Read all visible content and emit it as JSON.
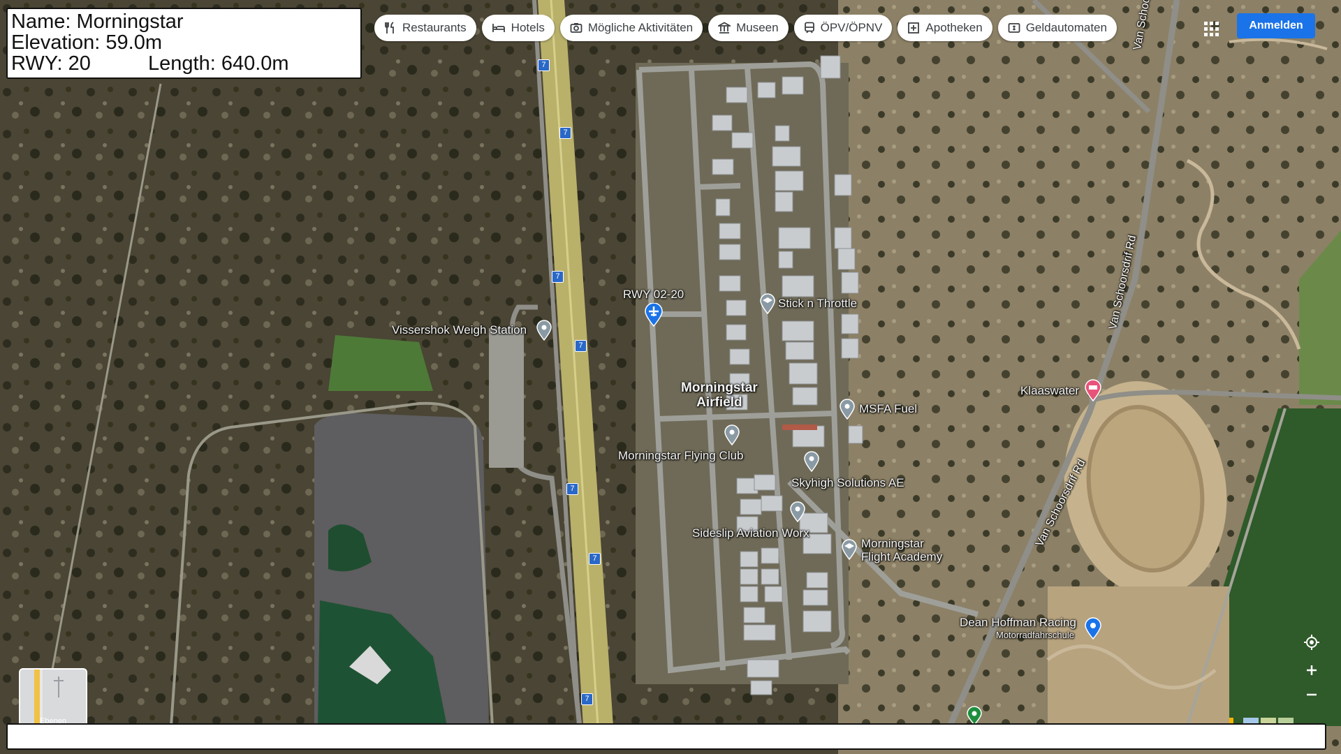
{
  "info_box": {
    "name": "Name: Morningstar",
    "elevation": "Elevation: 59.0m",
    "runway": "RWY: 20",
    "length": "Length: 640.0m"
  },
  "chips": [
    {
      "label": "Restaurants",
      "icon": "fork-knife-icon"
    },
    {
      "label": "Hotels",
      "icon": "bed-icon"
    },
    {
      "label": "Mögliche Aktivitäten",
      "icon": "camera-icon"
    },
    {
      "label": "Museen",
      "icon": "museum-icon"
    },
    {
      "label": "ÖPV/ÖPNV",
      "icon": "transit-icon"
    },
    {
      "label": "Apotheken",
      "icon": "pharmacy-icon"
    },
    {
      "label": "Geldautomaten",
      "icon": "atm-icon"
    }
  ],
  "signin_label": "Anmelden",
  "places": {
    "airfield": "Morningstar\nAirfield",
    "runway": "RWY 02-20",
    "weigh_station": "Vissershok Weigh Station",
    "stick_throttle": "Stick n Throttle",
    "msfa_fuel": "MSFA Fuel",
    "flying_club": "Morningstar Flying Club",
    "skyhigh": "Skyhigh Solutions AE",
    "sideslip": "Sideslip Aviation Worx",
    "flight_academy": "Morningstar\nFlight Academy",
    "klaaswater": "Klaaswater",
    "dean_hoffman": "Dean Hoffman Racing",
    "dean_hoffman_sub": "Motorradfahrschule"
  },
  "roads": {
    "van_schoorsdrif_1": "Van Schoorsdrif Rd",
    "van_schoorsdrif_2": "Van Schoorsdrif Rd",
    "van_schoorsdrif_3": "Van Schoorsdrif Rd",
    "route_shield": "7"
  },
  "layer_thumb_label": "Ebenen",
  "colors": {
    "signin": "#1a73e8",
    "pin_gray": "#8a9aa4",
    "pin_blue": "#1a73e8",
    "pin_pink": "#e8537a",
    "pin_green": "#1e8e3e"
  }
}
